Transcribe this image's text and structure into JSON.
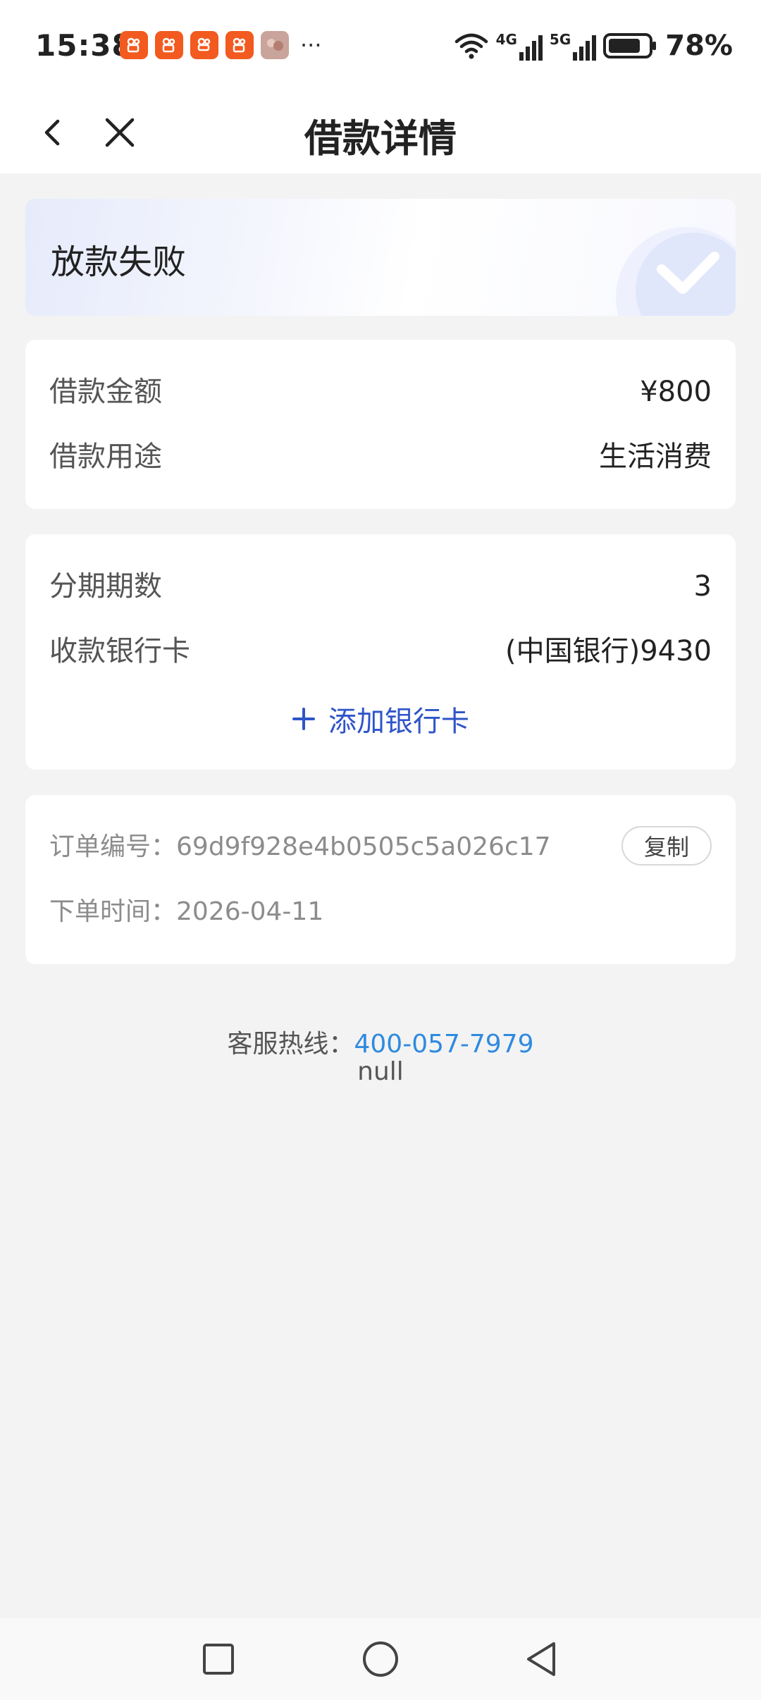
{
  "status_bar": {
    "time": "15:38",
    "more_indicator": "···",
    "battery": "78%",
    "network_1": "4G",
    "network_2": "5G"
  },
  "header": {
    "title": "借款详情"
  },
  "status_card": {
    "status": "放款失败"
  },
  "loan": {
    "amount_label": "借款金额",
    "amount_value": "¥800",
    "purpose_label": "借款用途",
    "purpose_value": "生活消费"
  },
  "bank": {
    "installments_label": "分期期数",
    "installments_value": "3",
    "card_label": "收款银行卡",
    "card_value": "(中国银行)9430",
    "add_card_label": "添加银行卡"
  },
  "order": {
    "number_label": "订单编号：",
    "number_value": "69d9f928e4b0505c5a026c17",
    "copy_label": "复制",
    "time_label": "下单时间：",
    "time_value": "2026-04-11"
  },
  "footer": {
    "hotline_label": "客服热线：",
    "hotline_phone": "400-057-7979",
    "extra": "null"
  },
  "colors": {
    "accent": "#2f55c8",
    "link": "#2f8ae0",
    "background": "#f3f3f3"
  }
}
